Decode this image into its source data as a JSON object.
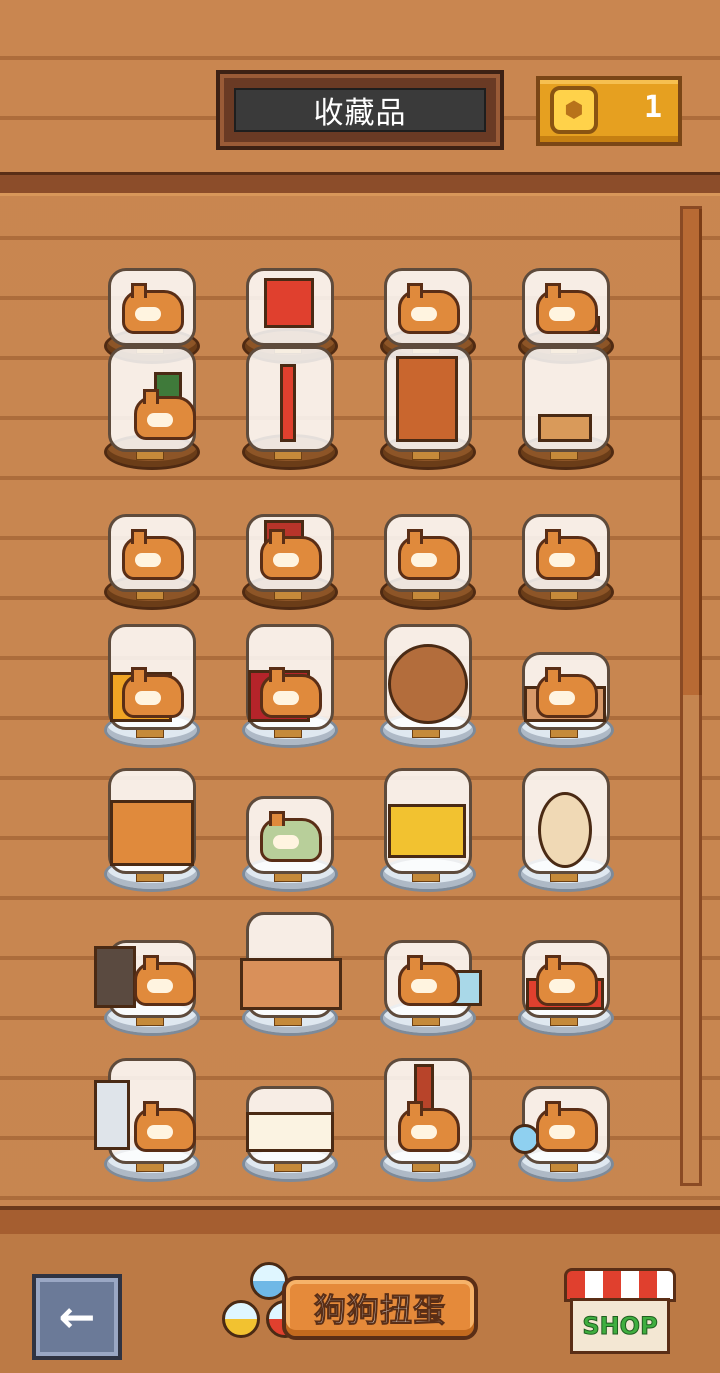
{
  "header": {
    "title": "收藏品",
    "coin_count": "1"
  },
  "collection": {
    "rows": [
      {
        "base": "wood",
        "items": [
          "shiba-lying",
          "framed-picture",
          "shiba-sitting",
          "shiba-with-bowl"
        ]
      },
      {
        "base": "wood",
        "items": [
          "shiba-with-cactus",
          "floor-lamp",
          "wardrobe",
          "plant-on-table"
        ]
      },
      {
        "base": "wood",
        "items": [
          "shiba-sleeping",
          "shiba-with-hat",
          "shiba-with-flowers",
          "shiba-with-box"
        ]
      },
      {
        "base": "silver",
        "items": [
          "shiba-armchair",
          "shiba-red-sofa",
          "round-window",
          "shiba-couch"
        ]
      },
      {
        "base": "silver",
        "items": [
          "tv-cabinet",
          "green-shiba",
          "computer-monitor",
          "oval-mirror"
        ]
      },
      {
        "base": "silver",
        "items": [
          "shiba-with-heater",
          "tv-stand",
          "shiba-with-planter",
          "shiba-dog-bed"
        ]
      },
      {
        "base": "silver",
        "items": [
          "boy-with-shiba",
          "dining-table",
          "shiba-with-kebab",
          "shiba-with-fishbowls"
        ]
      }
    ]
  },
  "footer": {
    "gacha_label": "狗狗扭蛋",
    "shop_label": "SHOP",
    "back_icon": "arrow-left-icon"
  },
  "colors": {
    "wood": "#c98650",
    "coin": "#e6a020",
    "gacha": "#e58a3a",
    "shop_text": "#3fae3f"
  }
}
